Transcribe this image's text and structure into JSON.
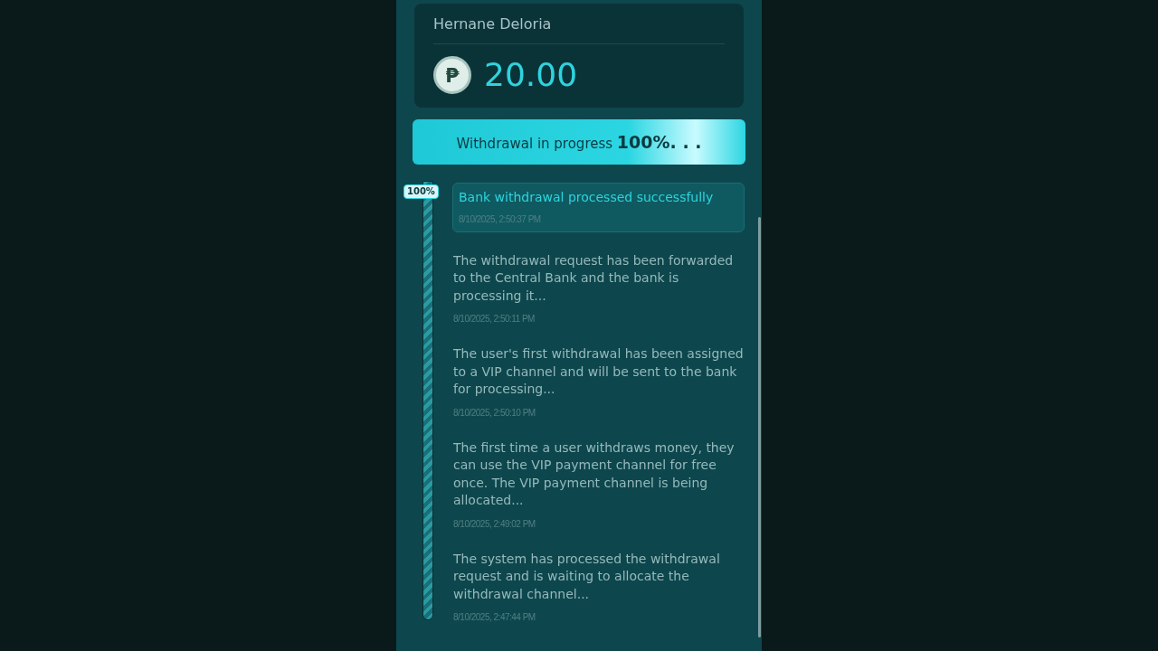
{
  "account": {
    "name": "Hernane Deloria",
    "currency_symbol": "₱",
    "amount": "20.00"
  },
  "progress": {
    "label": "Withdrawal in progress",
    "percent": "100%. . .",
    "level": 1
  },
  "timeline": {
    "badge": "100%",
    "level": 1,
    "events": [
      {
        "message": "Bank withdrawal processed successfully",
        "time": "8/10/2025, 2:50:37 PM",
        "highlighted": true
      },
      {
        "message": "The withdrawal request has been forwarded to the Central Bank and the bank is processing it...",
        "time": "8/10/2025, 2:50:11 PM",
        "highlighted": false
      },
      {
        "message": "The user's first withdrawal has been assigned to a VIP channel and will be sent to the bank for processing...",
        "time": "8/10/2025, 2:50:10 PM",
        "highlighted": false
      },
      {
        "message": "The first time a user withdraws money, they can use the VIP payment channel for free once. The VIP payment channel is being allocated...",
        "time": "8/10/2025, 2:49:02 PM",
        "highlighted": false
      },
      {
        "message": "The system has processed the withdrawal request and is waiting to allocate the withdrawal channel...",
        "time": "8/10/2025, 2:47:44 PM",
        "highlighted": false
      }
    ]
  }
}
